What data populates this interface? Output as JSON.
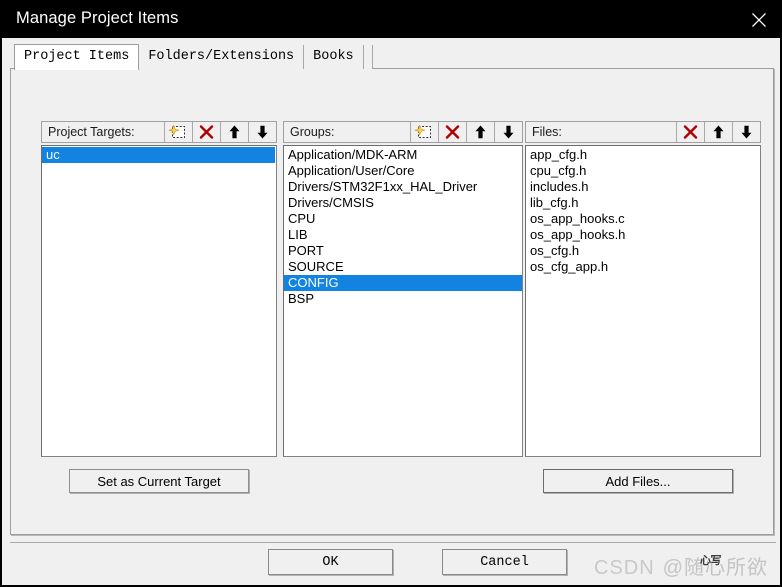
{
  "window": {
    "title": "Manage Project Items",
    "close_icon": "close-icon"
  },
  "tabs": [
    {
      "label": "Project Items",
      "active": true
    },
    {
      "label": "Folders/Extensions",
      "active": false
    },
    {
      "label": "Books",
      "active": false
    }
  ],
  "colors": {
    "titlebar_bg": "#000000",
    "dialog_bg": "#f0f0f0",
    "selection_blue": "#1283e0",
    "delete_red": "#b00000",
    "watermark_gray": "#c9c9c9"
  },
  "columns": {
    "targets": {
      "label": "Project Targets:",
      "buttons": [
        {
          "name": "new-item-icon",
          "title": "New (Insert)"
        },
        {
          "name": "delete-icon",
          "title": "Remove"
        },
        {
          "name": "move-up-icon",
          "title": "Move Up"
        },
        {
          "name": "move-down-icon",
          "title": "Move Down"
        }
      ],
      "items": [
        {
          "label": "uc",
          "selected": true
        }
      ]
    },
    "groups": {
      "label": "Groups:",
      "buttons": [
        {
          "name": "new-item-icon",
          "title": "New (Insert)"
        },
        {
          "name": "delete-icon",
          "title": "Remove"
        },
        {
          "name": "move-up-icon",
          "title": "Move Up"
        },
        {
          "name": "move-down-icon",
          "title": "Move Down"
        }
      ],
      "items": [
        {
          "label": "Application/MDK-ARM",
          "selected": false
        },
        {
          "label": "Application/User/Core",
          "selected": false
        },
        {
          "label": "Drivers/STM32F1xx_HAL_Driver",
          "selected": false
        },
        {
          "label": "Drivers/CMSIS",
          "selected": false
        },
        {
          "label": "CPU",
          "selected": false
        },
        {
          "label": "LIB",
          "selected": false
        },
        {
          "label": "PORT",
          "selected": false
        },
        {
          "label": "SOURCE",
          "selected": false
        },
        {
          "label": "CONFIG",
          "selected": true
        },
        {
          "label": "BSP",
          "selected": false
        }
      ]
    },
    "files": {
      "label": "Files:",
      "buttons": [
        {
          "name": "delete-icon",
          "title": "Remove"
        },
        {
          "name": "move-up-icon",
          "title": "Move Up"
        },
        {
          "name": "move-down-icon",
          "title": "Move Down"
        }
      ],
      "items": [
        {
          "label": "app_cfg.h",
          "selected": false
        },
        {
          "label": "cpu_cfg.h",
          "selected": false
        },
        {
          "label": "includes.h",
          "selected": false
        },
        {
          "label": "lib_cfg.h",
          "selected": false
        },
        {
          "label": "os_app_hooks.c",
          "selected": false
        },
        {
          "label": "os_app_hooks.h",
          "selected": false
        },
        {
          "label": "os_cfg.h",
          "selected": false
        },
        {
          "label": "os_cfg_app.h",
          "selected": false
        }
      ]
    }
  },
  "actions": {
    "set_as_current_target": "Set as Current Target",
    "add_files": "Add Files..."
  },
  "footer": {
    "ok": "OK",
    "cancel": "Cancel"
  },
  "watermark": {
    "brand": "CSDN",
    "user": "@随心所欲",
    "overlay": "心写"
  }
}
